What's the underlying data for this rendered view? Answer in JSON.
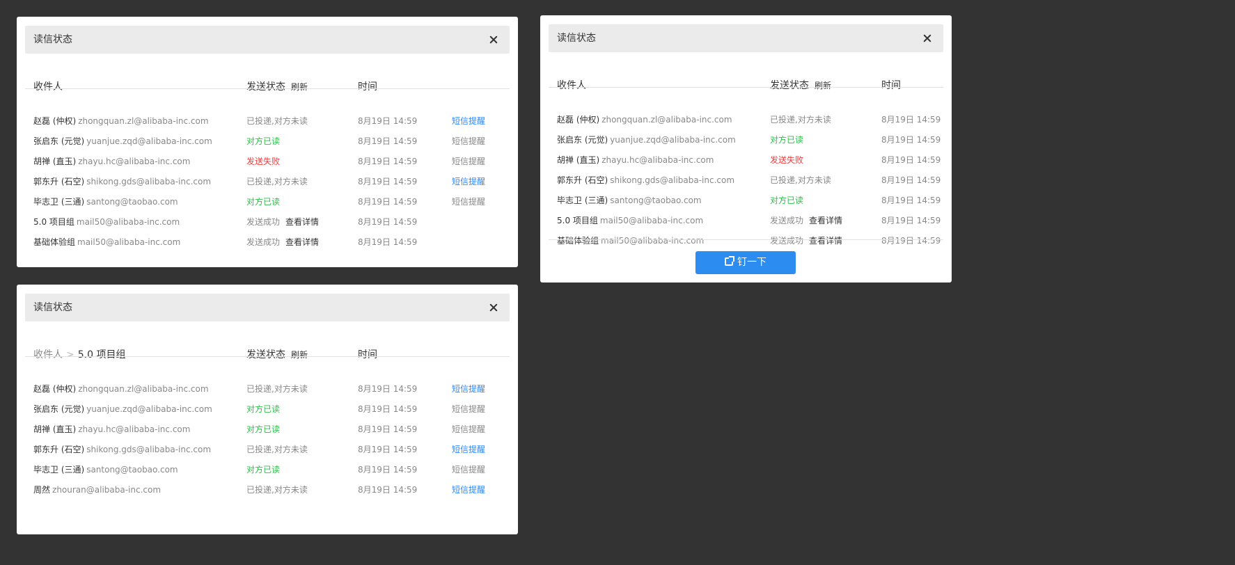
{
  "dialog_title": "读信状态",
  "columns": {
    "recipient": "收件人",
    "status": "发送状态",
    "refresh": "刷新",
    "time": "时间"
  },
  "breadcrumb": {
    "root": "收件人",
    "separator": ">",
    "current": "5.0 项目组"
  },
  "pin_button": "钉一下",
  "panel_main": {
    "rows": [
      {
        "name": "赵磊 (仲权)",
        "email": "zhongquan.zl@alibaba-inc.com",
        "status": "已投递,对方未读",
        "status_color": "#888888",
        "time": "8月19日 14:59",
        "sms": "短信提醒",
        "sms_color": "#2b88ff"
      },
      {
        "name": "张启东 (元觉)",
        "email": "yuanjue.zqd@alibaba-inc.com",
        "status": "对方已读",
        "status_color": "#2bbf48",
        "time": "8月19日 14:59",
        "sms": "短信提醒",
        "sms_color": "#888888"
      },
      {
        "name": "胡禅 (直玉)",
        "email": "zhayu.hc@alibaba-inc.com",
        "status": "发送失败",
        "status_color": "#f23c3c",
        "time": "8月19日 14:59",
        "sms": "短信提醒",
        "sms_color": "#888888"
      },
      {
        "name": "郭东升 (石空)",
        "email": "shikong.gds@alibaba-inc.com",
        "status": "已投递,对方未读",
        "status_color": "#888888",
        "time": "8月19日 14:59",
        "sms": "短信提醒",
        "sms_color": "#2b88ff"
      },
      {
        "name": "毕志卫 (三通)",
        "email": "santong@taobao.com",
        "status": "对方已读",
        "status_color": "#2bbf48",
        "time": "8月19日 14:59",
        "sms": "短信提醒",
        "sms_color": "#888888"
      },
      {
        "name": "5.0 项目组",
        "email": "mail50@alibaba-inc.com",
        "status": "发送成功",
        "status_color": "#888888",
        "detail": "查看详情",
        "time": "8月19日 14:59"
      },
      {
        "name": "基础体验组",
        "email": "mail50@alibaba-inc.com",
        "status": "发送成功",
        "status_color": "#888888",
        "detail": "查看详情",
        "time": "8月19日 14:59"
      }
    ]
  },
  "panel_group": {
    "rows": [
      {
        "name": "赵磊 (仲权)",
        "email": "zhongquan.zl@alibaba-inc.com",
        "status": "已投递,对方未读",
        "status_color": "#888888",
        "time": "8月19日 14:59",
        "sms": "短信提醒",
        "sms_color": "#2b88ff"
      },
      {
        "name": "张启东 (元觉)",
        "email": "yuanjue.zqd@alibaba-inc.com",
        "status": "对方已读",
        "status_color": "#2bbf48",
        "time": "8月19日 14:59",
        "sms": "短信提醒",
        "sms_color": "#888888"
      },
      {
        "name": "胡禅 (直玉)",
        "email": "zhayu.hc@alibaba-inc.com",
        "status": "对方已读",
        "status_color": "#2bbf48",
        "time": "8月19日 14:59",
        "sms": "短信提醒",
        "sms_color": "#888888"
      },
      {
        "name": "郭东升 (石空)",
        "email": "shikong.gds@alibaba-inc.com",
        "status": "已投递,对方未读",
        "status_color": "#888888",
        "time": "8月19日 14:59",
        "sms": "短信提醒",
        "sms_color": "#2b88ff"
      },
      {
        "name": "毕志卫 (三通)",
        "email": "santong@taobao.com",
        "status": "对方已读",
        "status_color": "#2bbf48",
        "time": "8月19日 14:59",
        "sms": "短信提醒",
        "sms_color": "#888888"
      },
      {
        "name": "周然",
        "email": "zhouran@alibaba-inc.com",
        "status": "已投递,对方未读",
        "status_color": "#888888",
        "time": "8月19日 14:59",
        "sms": "短信提醒",
        "sms_color": "#2b88ff"
      }
    ]
  },
  "panel_compact": {
    "rows": [
      {
        "name": "赵磊 (仲权)",
        "email": "zhongquan.zl@alibaba-inc.com",
        "status": "已投递,对方未读",
        "status_color": "#888888",
        "time": "8月19日 14:59"
      },
      {
        "name": "张启东 (元觉)",
        "email": "yuanjue.zqd@alibaba-inc.com",
        "status": "对方已读",
        "status_color": "#2bbf48",
        "time": "8月19日 14:59"
      },
      {
        "name": "胡禅 (直玉)",
        "email": "zhayu.hc@alibaba-inc.com",
        "status": "发送失败",
        "status_color": "#f23c3c",
        "time": "8月19日 14:59"
      },
      {
        "name": "郭东升 (石空)",
        "email": "shikong.gds@alibaba-inc.com",
        "status": "已投递,对方未读",
        "status_color": "#888888",
        "time": "8月19日 14:59"
      },
      {
        "name": "毕志卫 (三通)",
        "email": "santong@taobao.com",
        "status": "对方已读",
        "status_color": "#2bbf48",
        "time": "8月19日 14:59"
      },
      {
        "name": "5.0 项目组",
        "email": "mail50@alibaba-inc.com",
        "status": "发送成功",
        "status_color": "#888888",
        "detail": "查看详情",
        "time": "8月19日 14:59"
      },
      {
        "name": "基础体验组",
        "email": "mail50@alibaba-inc.com",
        "status": "发送成功",
        "status_color": "#888888",
        "detail": "查看详情",
        "time": "8月19日 14:59"
      }
    ]
  },
  "icons": {
    "close": "close-icon",
    "pin": "pin-icon"
  }
}
